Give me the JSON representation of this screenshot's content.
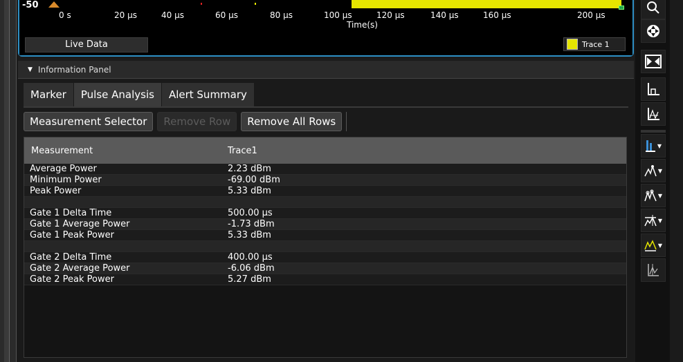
{
  "chart": {
    "y_top_label": "-50",
    "x_ticks": [
      "0 s",
      "20 µs",
      "40 µs",
      "60 µs",
      "80 µs",
      "100 µs",
      "120 µs",
      "140 µs",
      "160 µs",
      "200 µs"
    ],
    "x_axis_title": "Time(s)",
    "trace_color": "#e6e600"
  },
  "footer": {
    "live_tab": "Live Data",
    "legend_label": "Trace 1"
  },
  "info_panel": {
    "label": "Information Panel"
  },
  "tabs": [
    "Marker",
    "Pulse Analysis",
    "Alert Summary"
  ],
  "toolbar": {
    "measurement_selector": "Measurement Selector",
    "remove_row": "Remove Row",
    "remove_all_rows": "Remove All Rows"
  },
  "table": {
    "headers": [
      "Measurement",
      "Trace1"
    ],
    "rows": [
      [
        "Average Power",
        "2.23 dBm"
      ],
      [
        "Minimum Power",
        "-69.00 dBm"
      ],
      [
        "Peak Power",
        "5.33 dBm"
      ],
      [
        "",
        ""
      ],
      [
        "Gate 1 Delta Time",
        "500.00 µs"
      ],
      [
        "Gate 1 Average Power",
        "-1.73 dBm"
      ],
      [
        "Gate 1 Peak Power",
        "5.33 dBm"
      ],
      [
        "",
        ""
      ],
      [
        "Gate 2 Delta Time",
        "400.00 µs"
      ],
      [
        "Gate 2 Average Power",
        "-6.06 dBm"
      ],
      [
        "Gate 2 Peak Power",
        "5.27 dBm"
      ]
    ]
  },
  "right_toolbar": {
    "icons": [
      "zoom-icon",
      "pan-icon",
      "fit-icon",
      "autoscale-icon",
      "axis-icon",
      "bar-view-icon",
      "marker-icon",
      "multi-marker-icon",
      "peak-icon",
      "trace-icon",
      "analysis-icon"
    ]
  }
}
